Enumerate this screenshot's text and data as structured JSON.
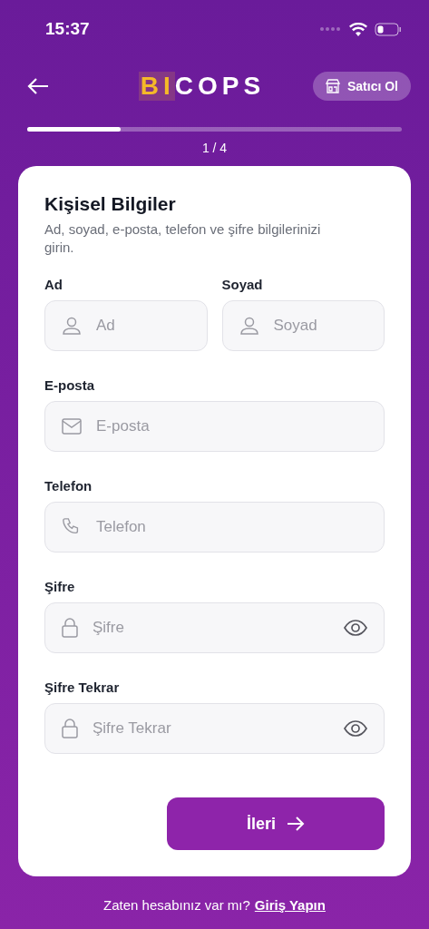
{
  "status_bar": {
    "time": "15:37"
  },
  "header": {
    "logo_highlight": "BI",
    "logo_rest": "COPS",
    "seller_button": "Satıcı Ol"
  },
  "progress": {
    "level": 0.25,
    "step": "1 / 4"
  },
  "form": {
    "title": "Kişisel Bilgiler",
    "subtitle": "Ad, soyad, e-posta, telefon ve şifre bilgilerinizi girin.",
    "rows": [
      [
        {
          "kind": "name",
          "label": "Ad",
          "placeholder": "Ad"
        },
        {
          "kind": "name",
          "label": "Soyad",
          "placeholder": "Soyad"
        }
      ],
      [
        {
          "kind": "email",
          "label": "E-posta",
          "placeholder": "E-posta"
        }
      ],
      [
        {
          "kind": "phone",
          "label": "Telefon",
          "placeholder": "Telefon"
        }
      ],
      [
        {
          "kind": "password",
          "label": "Şifre",
          "placeholder": "Şifre"
        }
      ],
      [
        {
          "kind": "password",
          "label": "Şifre Tekrar",
          "placeholder": "Şifre Tekrar"
        }
      ]
    ],
    "next_button": "İleri"
  },
  "footer": {
    "question": "Zaten hesabınız var mı?",
    "link": "Giriş Yapın"
  }
}
